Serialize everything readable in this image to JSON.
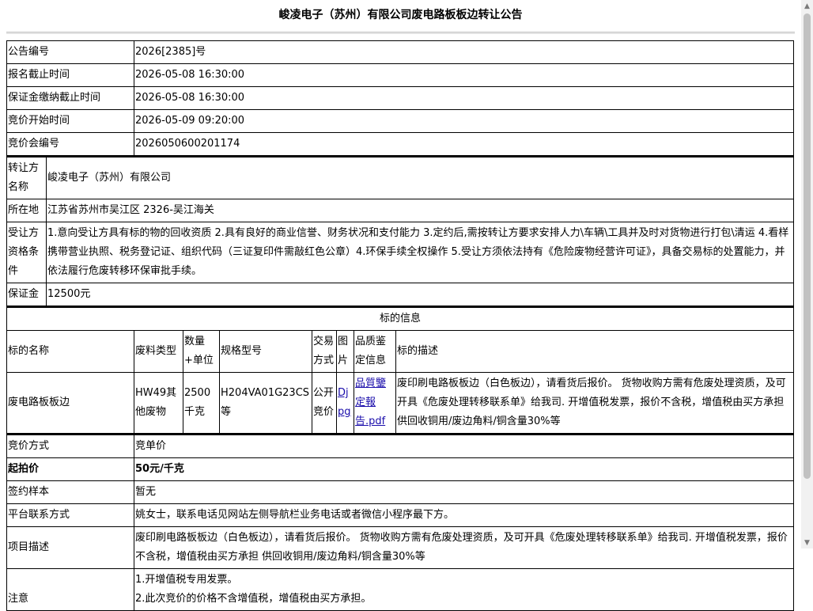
{
  "title": "峻凌电子（苏州）有限公司废电路板板边转让公告",
  "basic": [
    {
      "label": "公告编号",
      "value": "2026[2385]号"
    },
    {
      "label": "报名截止时间",
      "value": "2026-05-08 16:30:00"
    },
    {
      "label": "保证金缴纳截止时间",
      "value": "2026-05-08 16:30:00"
    },
    {
      "label": "竞价开始时间",
      "value": "2026-05-09 09:20:00"
    },
    {
      "label": "竞价会编号",
      "value": "2026050600201174"
    }
  ],
  "transferor": {
    "name_label": "转让方名称",
    "name_value": "峻凌电子（苏州）有限公司",
    "location_label": "所在地",
    "location_value": "江苏省苏州市吴江区 2326-吴江海关",
    "conditions_label": "受让方资格条件",
    "conditions_value": "1.意向受让方具有标的物的回收资质 2.具有良好的商业信誉、财务状况和支付能力 3.定约后,需按转让方要求安排人力\\车辆\\工具并及时对货物进行打包\\清运 4.看样携带营业执照、税务登记证、组织代码（三证复印件需敲红色公章）4.环保手续全权操作 5.受让方须依法持有《危险废物经营许可证》，具备交易标的处置能力，并依法履行危废转移环保审批手续。",
    "deposit_label": "保证金",
    "deposit_value": "12500元"
  },
  "subject": {
    "section_header": "标的信息",
    "headers": [
      "标的名称",
      "废料类型",
      "数量+单位",
      "规格型号",
      "交易方式",
      "图片",
      "品质鉴定信息",
      "标的描述"
    ],
    "row": {
      "name": "废电路板板边",
      "type": "HW49其他废物",
      "qty": "2500千克",
      "spec": "H204VA01G23CS等",
      "mode": "公开竞价",
      "image_link": "Djpg",
      "quality_link": "品質鑒定報告.pdf",
      "desc": "废印刷电路板板边（白色板边），请看货后报价。 货物收购方需有危废处理资质，及可开具《危废处理转移联系单》给我司. 开增值税发票，报价不含税，增值税由买方承担 供回收铜用/废边角料/铜含量30%等"
    }
  },
  "bidding": [
    {
      "label": "竞价方式",
      "value": "竞单价",
      "bold": false
    },
    {
      "label": "起拍价",
      "value": "50元/千克",
      "bold": true
    },
    {
      "label": "签约样本",
      "value": "暂无",
      "bold": false
    },
    {
      "label": "平台联系方式",
      "value": "姚女士，联系电话见网站左侧导航栏业务电话或者微信小程序最下方。",
      "bold": false
    },
    {
      "label": "项目描述",
      "value": "废印刷电路板板边（白色板边），请看货后报价。 货物收购方需有危废处理资质，及可开具《危废处理转移联系单》给我司. 开增值税发票，报价不含税，增值税由买方承担 供回收铜用/废边角料/铜含量30%等",
      "bold": false
    }
  ],
  "notes": {
    "label": "注意",
    "lines": [
      "1.开增值税专用发票。",
      "2.此次竞价的价格不含增值税，增值税由买方承担。"
    ]
  },
  "icons": {
    "scroll_up": "arrow-up-icon",
    "scroll_down": "arrow-down-icon"
  }
}
